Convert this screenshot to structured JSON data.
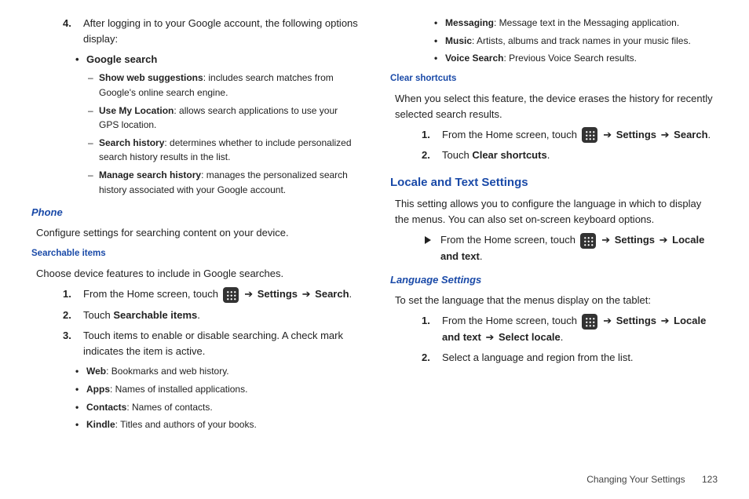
{
  "left": {
    "step4_num": "4.",
    "step4_text": "After logging in to your Google account, the following options display:",
    "google_search": "Google search",
    "sws_label": "Show web suggestions",
    "sws_desc": ": includes search matches from Google's online search engine.",
    "uml_label": "Use My Location",
    "uml_desc": ": allows search applications to use your GPS location.",
    "sh_label": "Search history",
    "sh_desc": ": determines whether to include personalized search history results in the list.",
    "msh_label": "Manage search history",
    "msh_desc": ": manages the personalized search history associated with your Google account.",
    "phone_heading": "Phone",
    "phone_para": "Configure settings for searching content on your device.",
    "searchable_heading": "Searchable items",
    "searchable_para": "Choose device features to include in Google searches.",
    "s1_num": "1.",
    "s1_a": "From the Home screen, touch ",
    "s1_b": " Settings ",
    "s1_c": " Search",
    "s2_num": "2.",
    "s2_a": "Touch ",
    "s2_b": "Searchable items",
    "s3_num": "3.",
    "s3_text": "Touch items to enable or disable searching. A check mark indicates the item is active.",
    "web_l": "Web",
    "web_d": ": Bookmarks and web history.",
    "apps_l": "Apps",
    "apps_d": ": Names of installed applications.",
    "contacts_l": "Contacts",
    "contacts_d": ": Names of contacts.",
    "kindle_l": "Kindle",
    "kindle_d": ": Titles and authors of your books."
  },
  "right": {
    "msg_l": "Messaging",
    "msg_d": ": Message text in the Messaging application.",
    "music_l": "Music",
    "music_d": ": Artists, albums and track names in your music files.",
    "vs_l": "Voice Search",
    "vs_d": ": Previous Voice Search results.",
    "clear_heading": "Clear shortcuts",
    "clear_para": "When you select this feature, the device erases the history for recently selected search results.",
    "c1_num": "1.",
    "c1_a": "From the Home screen, touch ",
    "c1_b": " Settings ",
    "c1_c": " Search",
    "c2_num": "2.",
    "c2_a": "Touch ",
    "c2_b": "Clear shortcuts",
    "locale_heading": "Locale and Text Settings",
    "locale_para": "This setting allows you to configure the language in which to display the menus. You can also set on-screen keyboard options.",
    "loc_a": "From the Home screen, touch ",
    "loc_b": " Settings ",
    "loc_c": " Locale and text",
    "lang_heading": "Language Settings",
    "lang_para": "To set the language that the menus display on the tablet:",
    "l1_num": "1.",
    "l1_a": "From the Home screen, touch ",
    "l1_b": " Settings ",
    "l1_c": " Locale and text ",
    "l1_d": " Select locale",
    "l2_num": "2.",
    "l2_text": "Select a language and region from the list."
  },
  "arrow": "➔",
  "footer": {
    "section": "Changing Your Settings",
    "page": "123"
  }
}
